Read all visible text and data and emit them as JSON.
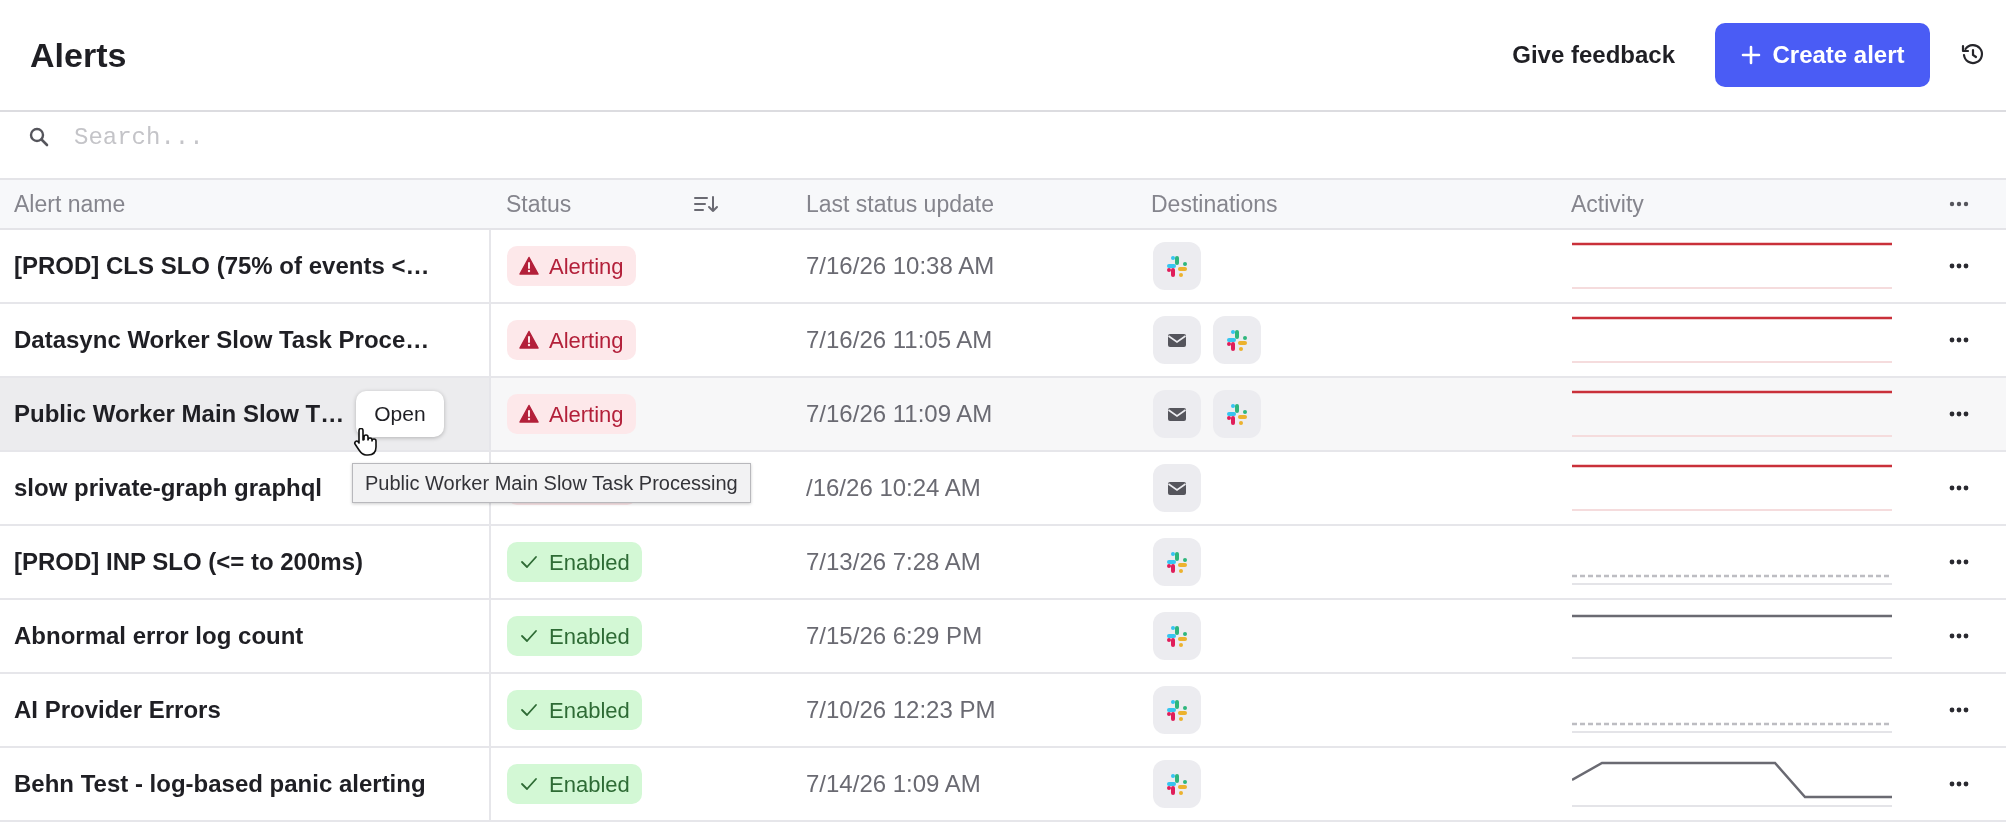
{
  "page": {
    "title": "Alerts"
  },
  "header_actions": {
    "feedback": "Give feedback",
    "create": "Create alert"
  },
  "search": {
    "placeholder": "Search..."
  },
  "columns": [
    "Alert name",
    "Status",
    "Last status update",
    "Destinations",
    "Activity"
  ],
  "rows": [
    {
      "name": "[PROD] CLS SLO (75% of events <…",
      "hovered": false,
      "status": {
        "kind": "alerting",
        "label": "Alerting"
      },
      "updated": "7/16/26 10:38 AM",
      "destinations": [
        {
          "kind": "slack"
        }
      ],
      "activity": {
        "kind": "alerting"
      }
    },
    {
      "name": "Datasync Worker Slow Task Proce…",
      "hovered": false,
      "status": {
        "kind": "alerting",
        "label": "Alerting"
      },
      "updated": "7/16/26 11:05 AM",
      "destinations": [
        {
          "kind": "email"
        },
        {
          "kind": "slack"
        }
      ],
      "activity": {
        "kind": "alerting"
      }
    },
    {
      "name": "Public Worker Main Slow T…",
      "hovered": true,
      "open_button": "Open",
      "tooltip": "Public Worker Main Slow Task Processing",
      "status": {
        "kind": "alerting",
        "label": "Alerting"
      },
      "updated": "7/16/26 11:09 AM",
      "destinations": [
        {
          "kind": "email"
        },
        {
          "kind": "slack"
        }
      ],
      "activity": {
        "kind": "alerting"
      }
    },
    {
      "name": "slow private-graph graphql",
      "hovered": false,
      "status": {
        "kind": "alerting"
      },
      "updated": "/16/26 10:24 AM",
      "destinations": [
        {
          "kind": "email"
        }
      ],
      "activity": {
        "kind": "alerting"
      }
    },
    {
      "name": "[PROD] INP SLO (<= to 200ms)",
      "hovered": false,
      "status": {
        "kind": "enabled",
        "label": "Enabled"
      },
      "updated": "7/13/26 7:28 AM",
      "destinations": [
        {
          "kind": "slack"
        }
      ],
      "activity": {
        "kind": "none"
      }
    },
    {
      "name": "Abnormal error log count",
      "hovered": false,
      "status": {
        "kind": "enabled",
        "label": "Enabled"
      },
      "updated": "7/15/26 6:29 PM",
      "destinations": [
        {
          "kind": "slack"
        }
      ],
      "activity": {
        "kind": "flat"
      }
    },
    {
      "name": "AI Provider Errors",
      "hovered": false,
      "status": {
        "kind": "enabled",
        "label": "Enabled"
      },
      "updated": "7/10/26 12:23 PM",
      "destinations": [
        {
          "kind": "slack"
        }
      ],
      "activity": {
        "kind": "none"
      }
    },
    {
      "name": "Behn Test - log-based panic alerting",
      "hovered": false,
      "status": {
        "kind": "enabled",
        "label": "Enabled"
      },
      "updated": "7/14/26 1:09 AM",
      "destinations": [
        {
          "kind": "slack"
        }
      ],
      "activity": {
        "kind": "step"
      }
    }
  ]
}
